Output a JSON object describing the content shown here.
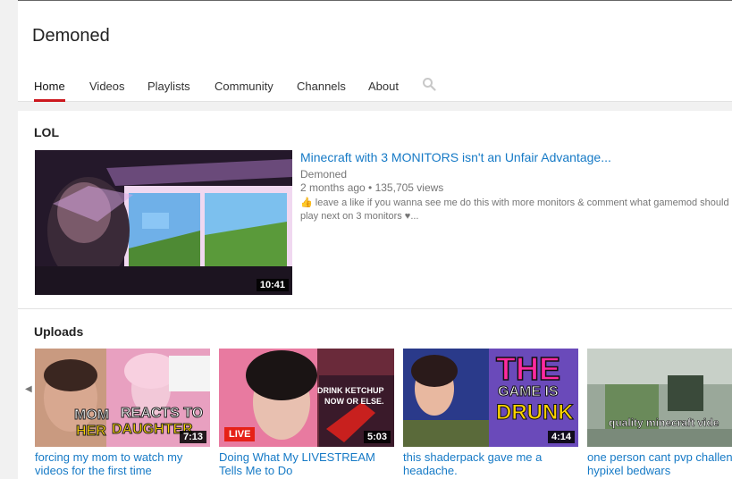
{
  "channel": {
    "name": "Demoned"
  },
  "tabs": [
    {
      "label": "Home",
      "active": true
    },
    {
      "label": "Videos"
    },
    {
      "label": "Playlists"
    },
    {
      "label": "Community"
    },
    {
      "label": "Channels"
    },
    {
      "label": "About"
    }
  ],
  "icons": {
    "search": "search-icon"
  },
  "featured": {
    "section_title": "LOL",
    "title": "Minecraft with 3 MONITORS isn't an Unfair Advantage...",
    "channel": "Demoned",
    "meta": "2 months ago • 135,705 views",
    "description": "👍 leave a like if you wanna see me do this with more monitors & comment what gamemod should play next on 3 monitors ♥...",
    "duration": "10:41"
  },
  "uploads": {
    "section_title": "Uploads",
    "items": [
      {
        "title_line1": "forcing my mom to watch my",
        "title_line2": "videos for the first time",
        "duration": "7:13",
        "overlay_text": [
          "MOM",
          "REACTS TO",
          "HER",
          "DAUGHTER"
        ]
      },
      {
        "title_line1": "Doing What My LIVESTREAM",
        "title_line2": "Tells Me to Do",
        "duration": "5:03",
        "badge": "LIVE",
        "overlay_text": [
          "DRINK KETCHUP",
          "NOW OR ELSE."
        ]
      },
      {
        "title_line1": "this shaderpack gave me a",
        "title_line2": "headache.",
        "duration": "4:14",
        "overlay_text": [
          "THE",
          "GAME IS",
          "DRUNK"
        ]
      },
      {
        "title_line1": "one person cant pvp challen",
        "title_line2": "hypixel bedwars",
        "overlay_text": [
          "quality minecraft vide"
        ]
      }
    ]
  },
  "colors": {
    "link": "#167ac6",
    "active_tab": "#cc181e",
    "live": "#e62117"
  }
}
